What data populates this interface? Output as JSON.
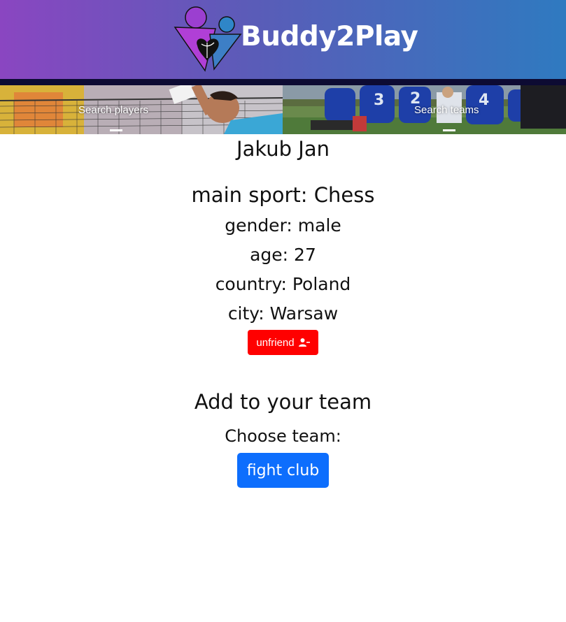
{
  "header": {
    "brand": "Buddy2Play",
    "logo_icon": "friends-heart-volleyball-logo",
    "gradient_colors": [
      "#8a46c1",
      "#2f7ac0"
    ],
    "bar_color": "#0d0b33"
  },
  "nav": {
    "tabs": [
      {
        "label": "Search players",
        "icon": "volleyball-player-photo"
      },
      {
        "label": "Search teams",
        "icon": "football-team-photo"
      }
    ]
  },
  "profile": {
    "name": "Jakub Jan",
    "main_sport": "main sport: Chess",
    "gender": "gender: male",
    "age": "age: 27",
    "country": "country: Poland",
    "city": "city: Warsaw",
    "unfriend_label": "unfriend",
    "unfriend_icon": "person-remove-icon",
    "unfriend_color": "#ff0000"
  },
  "team": {
    "heading": "Add to your team",
    "choose_label": "Choose team:",
    "team_button_label": "fight club",
    "team_button_color": "#0d6efd"
  }
}
